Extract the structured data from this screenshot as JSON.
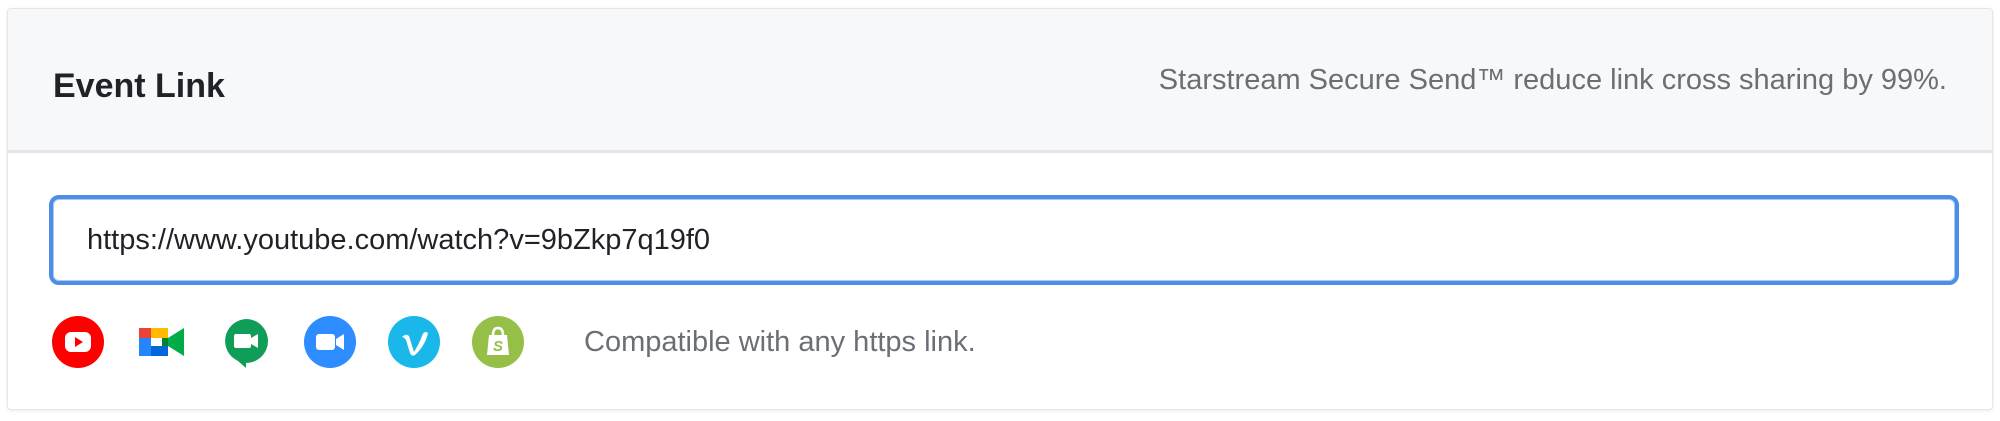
{
  "header": {
    "title": "Event Link",
    "subtitle": "Starstream Secure Send™ reduce link cross sharing by 99%."
  },
  "link_input": {
    "value": "https://www.youtube.com/watch?v=9bZkp7q19f0"
  },
  "compatibility": {
    "icons": [
      "youtube-icon",
      "google-meet-icon",
      "google-hangouts-icon",
      "zoom-icon",
      "vimeo-icon",
      "shopify-icon"
    ],
    "text": "Compatible with any https link."
  },
  "colors": {
    "focus_border": "#4c8ee6",
    "youtube": "#ff0000",
    "hangouts": "#0f9d58",
    "zoom": "#2d8cff",
    "vimeo": "#1ab7ea",
    "shopify": "#95bf47"
  }
}
